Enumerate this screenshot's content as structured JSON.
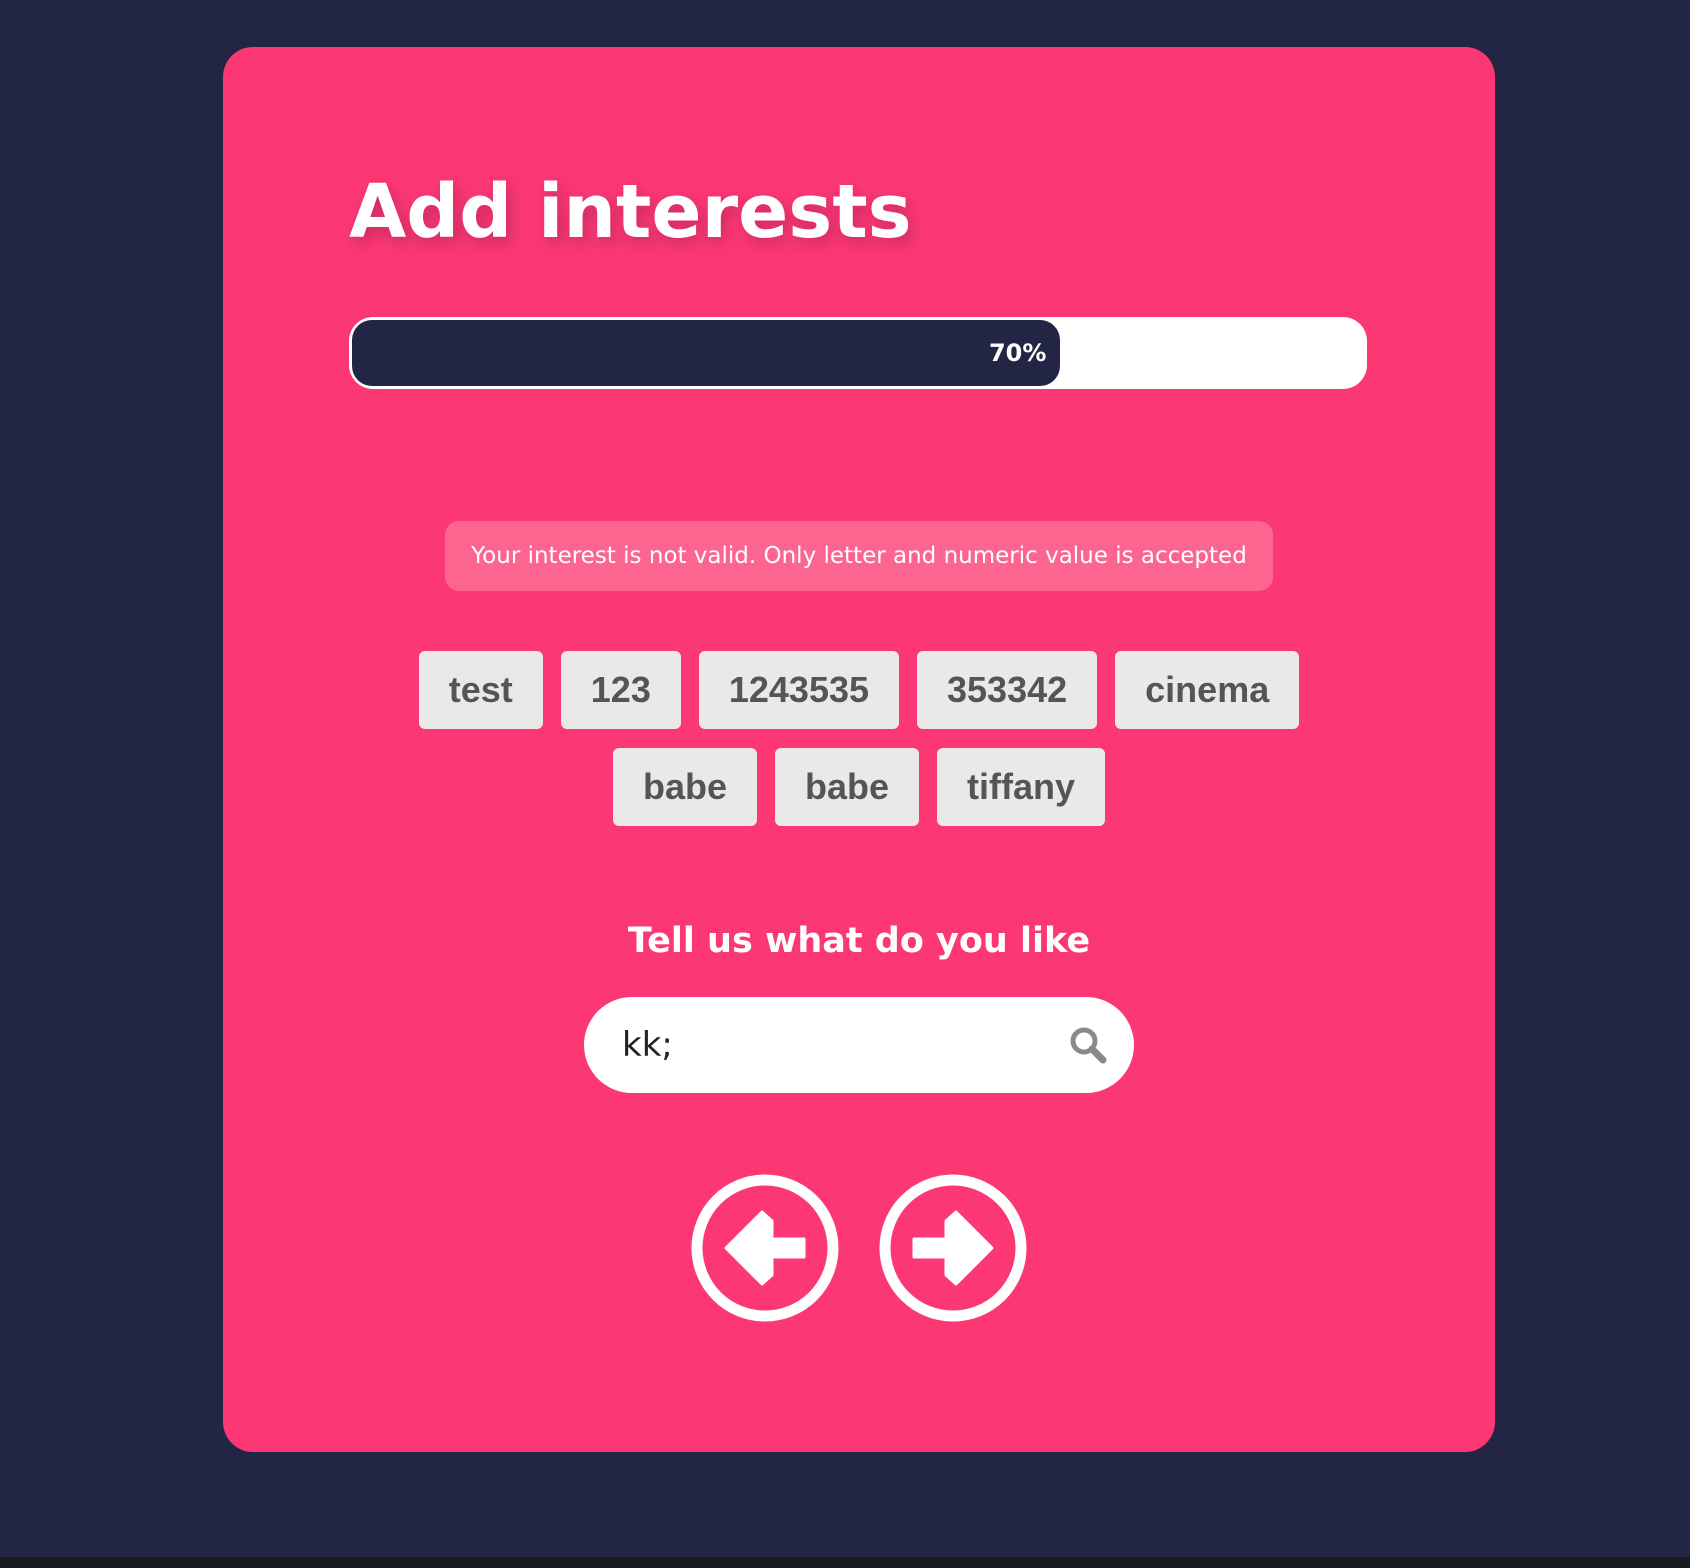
{
  "page": {
    "title": "Add interests"
  },
  "progress": {
    "value_percent": 70,
    "label": "70%"
  },
  "error": {
    "message": "Your interest is not valid. Only letter and numeric value is accepted"
  },
  "interests": {
    "rows": [
      [
        "test",
        "123",
        "1243535",
        "353342",
        "cinema"
      ],
      [
        "babe",
        "babe",
        "tiffany"
      ]
    ]
  },
  "prompt": {
    "text": "Tell us what do you like"
  },
  "search": {
    "value": "kk;",
    "icon": "search-icon"
  },
  "navigation": {
    "back_icon": "arrow-left-circle-icon",
    "next_icon": "arrow-right-circle-icon"
  },
  "colors": {
    "background": "#222544",
    "card": "#fb3874",
    "error_bg": "#fb6590",
    "tag_bg": "#e9e9e9",
    "tag_text": "#555555",
    "progress_fill": "#222544"
  }
}
